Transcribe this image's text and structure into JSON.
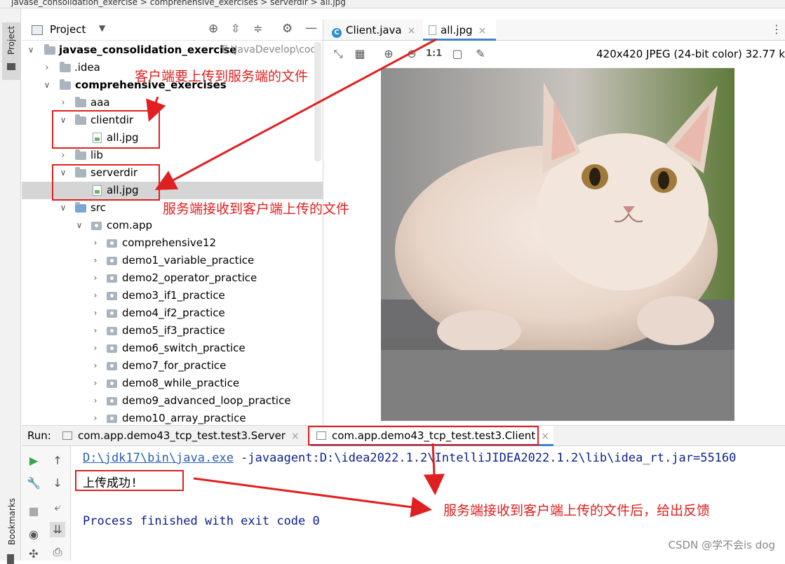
{
  "breadcrumb": "javase_consolidation_exercise  >  comprehensive_exercises  >  serverdir  >  all.jpg",
  "sidebar": {
    "project_tab": "Project",
    "bookmarks_tab": "Bookmarks"
  },
  "project_panel": {
    "title": "Project"
  },
  "tree": [
    {
      "label": "javase_consolidation_exercise",
      "path": "E:\\JavaDevelop\\cod"
    },
    {
      "label": ".idea"
    },
    {
      "label": "comprehensive_exercises"
    },
    {
      "label": "aaa"
    },
    {
      "label": "clientdir"
    },
    {
      "label": "all.jpg"
    },
    {
      "label": "lib"
    },
    {
      "label": "serverdir"
    },
    {
      "label": "all.jpg"
    },
    {
      "label": "src"
    },
    {
      "label": "com.app"
    },
    {
      "label": "comprehensive12"
    },
    {
      "label": "demo1_variable_practice"
    },
    {
      "label": "demo2_operator_practice"
    },
    {
      "label": "demo3_if1_practice"
    },
    {
      "label": "demo4_if2_practice"
    },
    {
      "label": "demo5_if3_practice"
    },
    {
      "label": "demo6_switch_practice"
    },
    {
      "label": "demo7_for_practice"
    },
    {
      "label": "demo8_while_practice"
    },
    {
      "label": "demo9_advanced_loop_practice"
    },
    {
      "label": "demo10_array_practice"
    }
  ],
  "editor_tabs": [
    {
      "label": "Client.java"
    },
    {
      "label": "all.jpg"
    }
  ],
  "image_info": "420x420 JPEG (24-bit color) 32.77 k",
  "zoom_label": "1:1",
  "run": {
    "label": "Run:",
    "tabs": [
      {
        "label": "com.app.demo43_tcp_test.test3.Server"
      },
      {
        "label": "com.app.demo43_tcp_test.test3.Client"
      }
    ]
  },
  "console": {
    "java_path": "D:\\jdk17\\bin\\java.exe",
    "cmd_args": " -javaagent:D:\\idea2022.1.2\\IntelliJIDEA2022.1.2\\lib\\idea_rt.jar=55160",
    "output": "上传成功!",
    "finished": "Process finished with exit code 0"
  },
  "annotations": {
    "client_upload": "客户端要上传到服务端的文件",
    "server_receive": "服务端接收到客户端上传的文件",
    "feedback": "服务端接收到客户端上传的文件后，给出反馈"
  },
  "watermark": "CSDN @学不会is dog",
  "colors": {
    "annotation": "#e02020",
    "selection": "#d5d5d5",
    "link": "#2a5db0",
    "console_text": "#0a1f8a",
    "tab_underline": "#4083c9"
  }
}
